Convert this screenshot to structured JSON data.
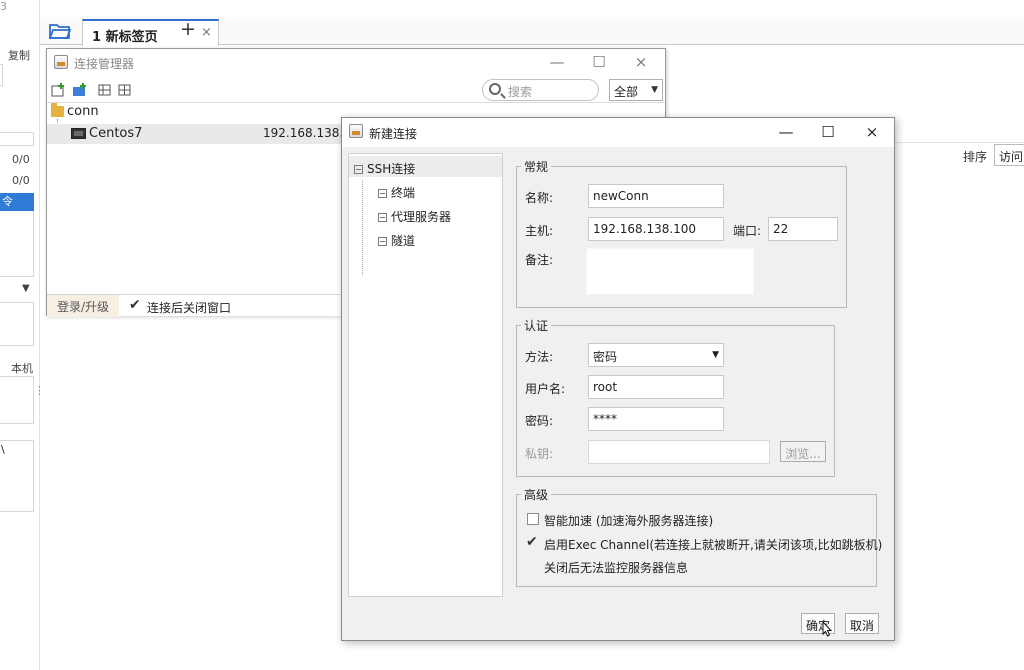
{
  "left_panel": {
    "top_fragment": "3",
    "copy_label": "复制",
    "count_a": "0/0",
    "count_b": "0/0",
    "selected_item": "令",
    "local_label": "本机",
    "bottom_fragment": "\\"
  },
  "tabbar": {
    "tab_label": "1 新标签页",
    "close_glyph": "×",
    "add_glyph": "+"
  },
  "sort": {
    "label": "排序",
    "value": "访问"
  },
  "conn_manager": {
    "title": "连接管理器",
    "minimize": "—",
    "maximize": "☐",
    "close": "×",
    "search_placeholder": "搜索",
    "filter_value": "全部",
    "tree_root": "conn",
    "rows": [
      {
        "name": "Centos7",
        "host": "192.168.138.13"
      }
    ],
    "status_left": "登录/升级",
    "close_after_connect_label": "连接后关闭窗口",
    "close_after_connect_checked": true
  },
  "new_conn": {
    "title": "新建连接",
    "minimize": "—",
    "maximize": "☐",
    "close": "×",
    "nav": {
      "root": "SSH连接",
      "items": [
        "终端",
        "代理服务器",
        "隧道"
      ]
    },
    "general": {
      "title": "常规",
      "name_label": "名称:",
      "name_value": "newConn",
      "host_label": "主机:",
      "host_value": "192.168.138.100",
      "port_label": "端口:",
      "port_value": "22",
      "note_label": "备注:",
      "note_value": ""
    },
    "auth": {
      "title": "认证",
      "method_label": "方法:",
      "method_value": "密码",
      "user_label": "用户名:",
      "user_value": "root",
      "password_label": "密码:",
      "password_value": "****",
      "key_label": "私钥:",
      "key_value": "",
      "browse_label": "浏览..."
    },
    "advanced": {
      "title": "高级",
      "accel_label": "智能加速 (加速海外服务器连接)",
      "accel_checked": false,
      "exec_label": "启用Exec Channel(若连接上就被断开,请关闭该项,比如跳板机)",
      "exec_checked": true,
      "exec_note": "关闭后无法监控服务器信息"
    },
    "ok_label": "确定",
    "cancel_label": "取消"
  },
  "colors": {
    "accent": "#2f6fd1",
    "selection": "#2f7bd6",
    "dialog_bg": "#f0f0f0"
  }
}
